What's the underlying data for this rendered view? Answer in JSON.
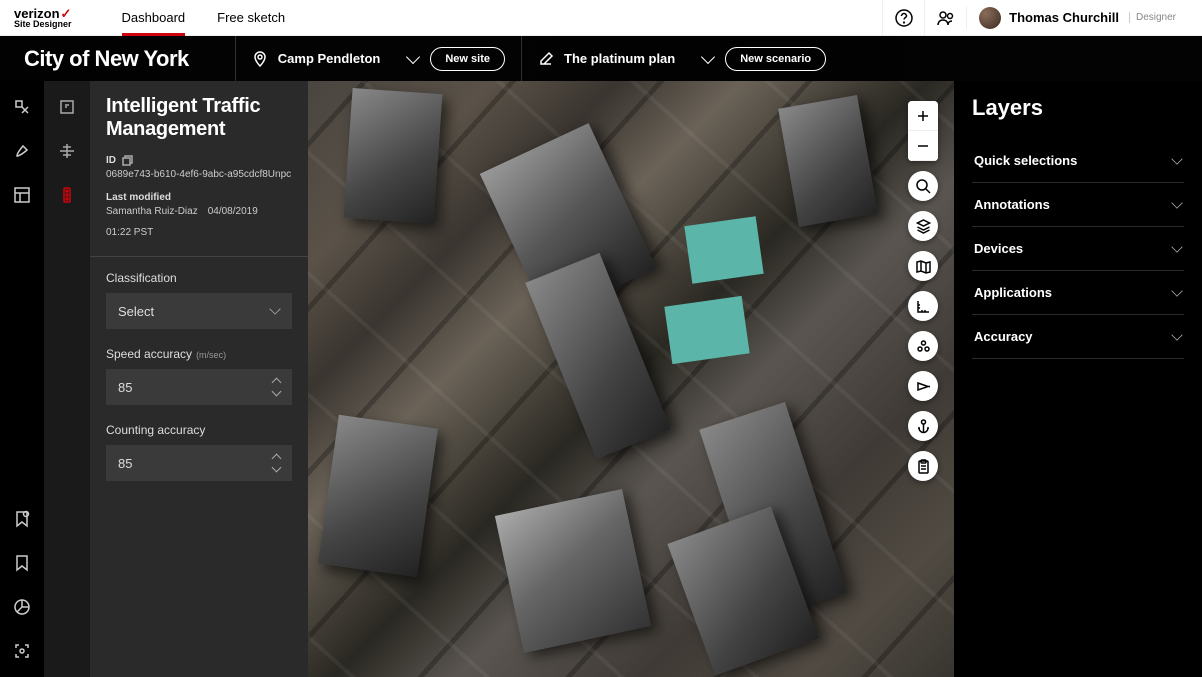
{
  "brand": {
    "name": "verizon",
    "sub": "Site Designer"
  },
  "top_tabs": [
    {
      "label": "Dashboard",
      "active": true
    },
    {
      "label": "Free sketch",
      "active": false
    }
  ],
  "user": {
    "name": "Thomas Churchill",
    "role": "Designer"
  },
  "subbar": {
    "city": "City of New York",
    "site_label": "Camp Pendleton",
    "new_site": "New site",
    "plan_label": "The platinum plan",
    "new_scenario": "New scenario"
  },
  "panel": {
    "title": "Intelligent Traffic Management",
    "id_label": "ID",
    "id_value": "0689e743-b610-4ef6-9abc-a95cdcf8Unpc",
    "modified_label": "Last modified",
    "modified_by": "Samantha Ruiz-Diaz",
    "modified_date": "04/08/2019",
    "modified_time": "01:22 PST",
    "classification": {
      "label": "Classification",
      "value": "Select"
    },
    "speed": {
      "label": "Speed accuracy",
      "unit": "(m/sec)",
      "value": "85"
    },
    "counting": {
      "label": "Counting accuracy",
      "value": "85"
    }
  },
  "layers": {
    "title": "Layers",
    "items": [
      {
        "label": "Quick selections"
      },
      {
        "label": "Annotations"
      },
      {
        "label": "Devices"
      },
      {
        "label": "Applications"
      },
      {
        "label": "Accuracy"
      }
    ]
  }
}
